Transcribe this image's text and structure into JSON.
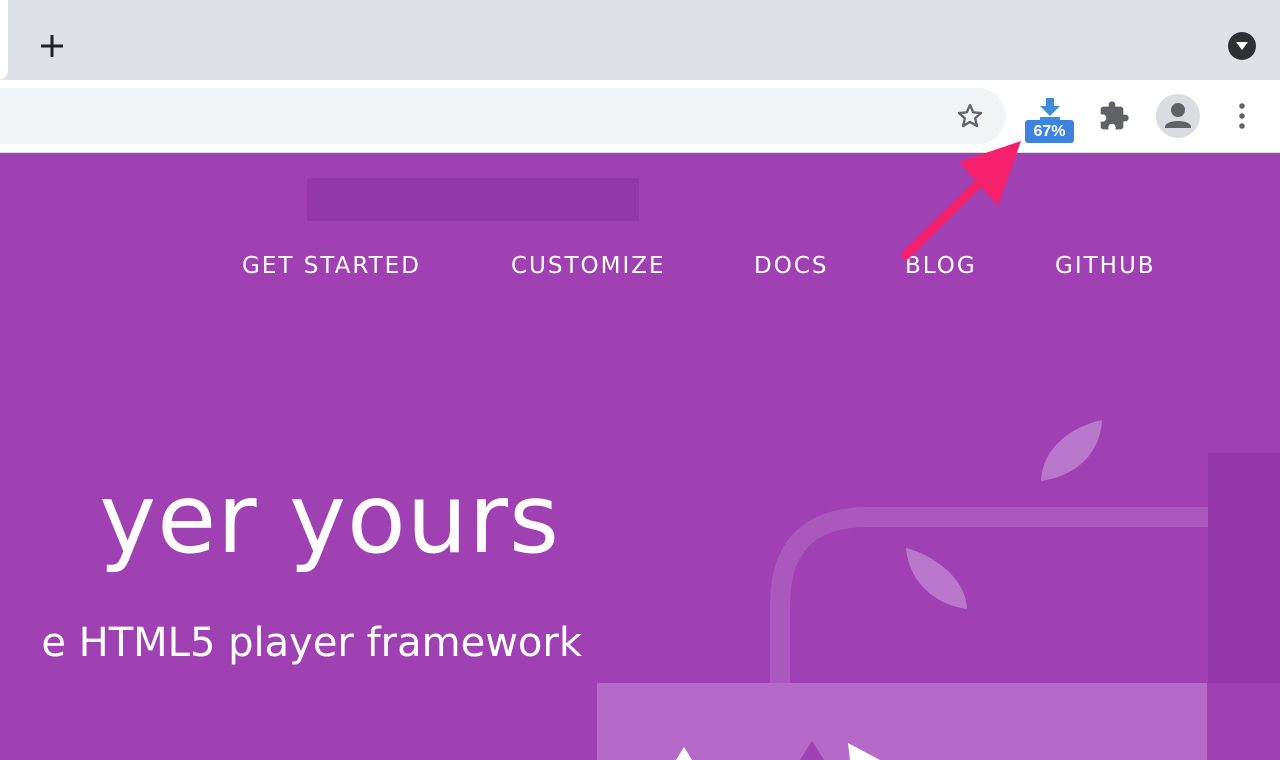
{
  "browser": {
    "download_badge": "67%",
    "icons": {
      "new_tab": "plus-icon",
      "tab_search": "chevron-down-icon",
      "bookmark": "star-icon",
      "download": "download-arrow-icon",
      "extensions": "puzzle-piece-icon",
      "profile": "person-icon",
      "menu": "kebab-menu-icon"
    }
  },
  "site": {
    "nav": [
      "GET STARTED",
      "CUSTOMIZE",
      "DOCS",
      "BLOG",
      "GITHUB"
    ],
    "hero_title": "yer yours",
    "hero_subtitle": "e HTML5 player framework"
  },
  "colors": {
    "page_bg": "#9f40b3",
    "callout_arrow": "#f5206b",
    "download_badge": "#3d83df",
    "download_arrow": "#3d8ed2"
  }
}
